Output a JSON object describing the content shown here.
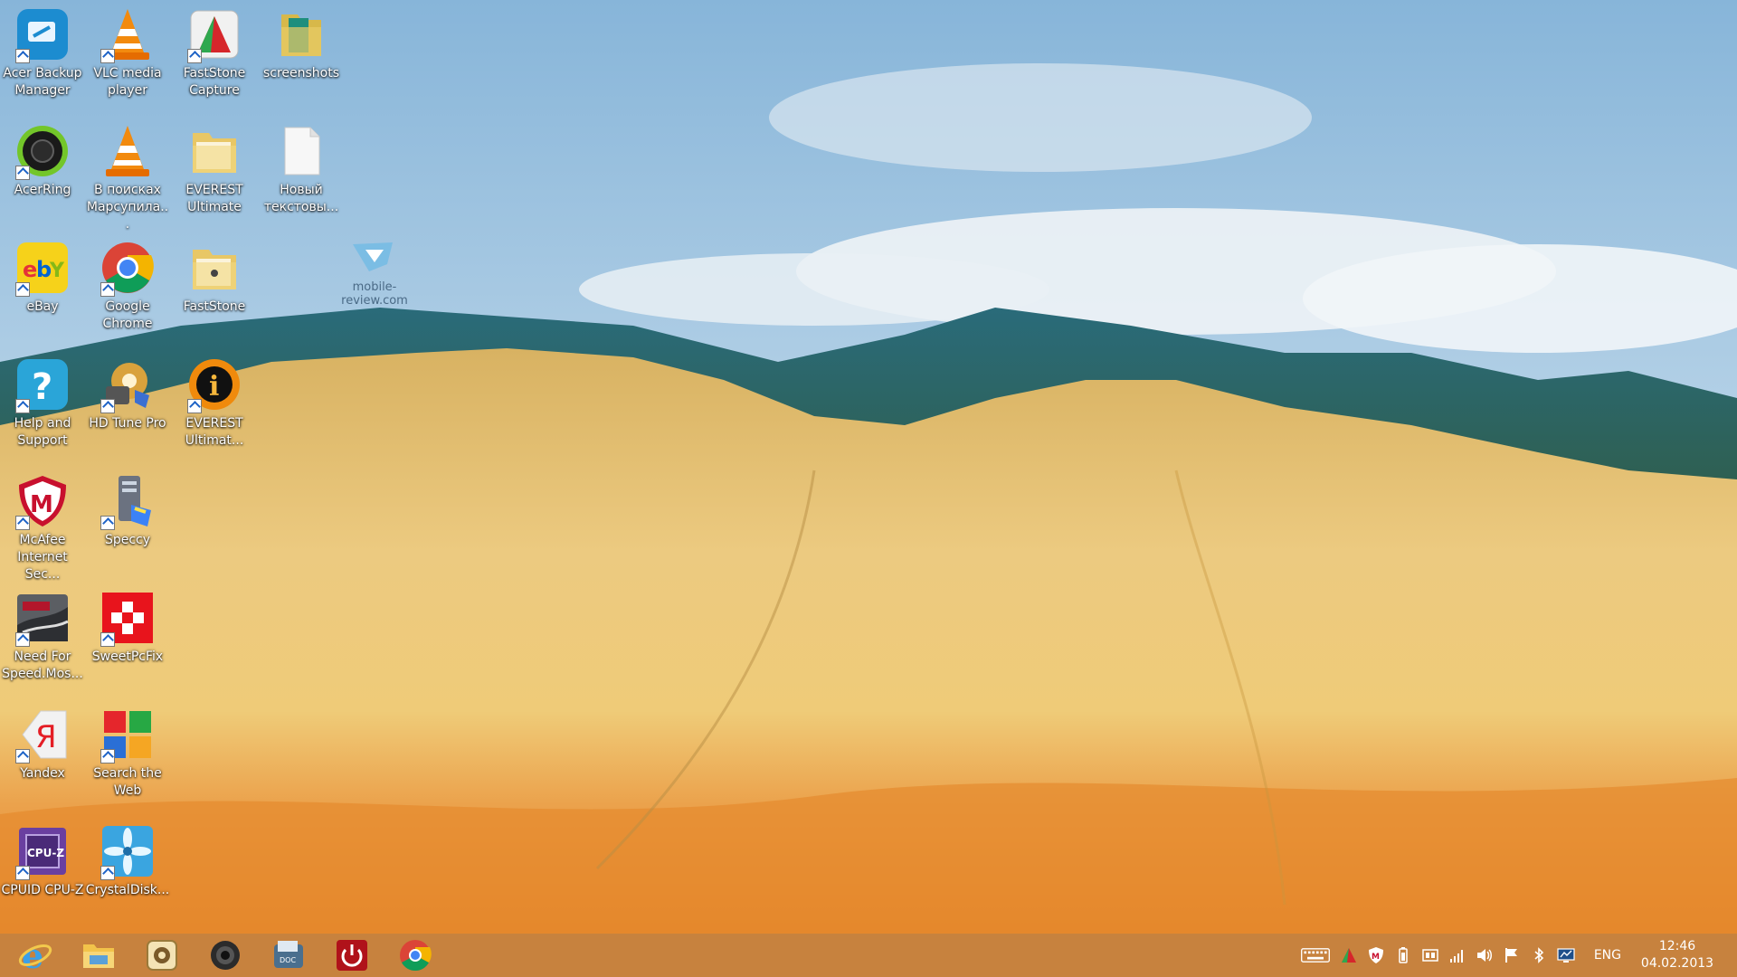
{
  "desktop": {
    "watermark": "mobile-review.com",
    "icons": [
      {
        "label": "Acer Backup Manager",
        "icon": "acer-backup-icon",
        "shortcut": true
      },
      {
        "label": "VLC media player",
        "icon": "vlc-icon",
        "shortcut": true
      },
      {
        "label": "FastStone Capture",
        "icon": "faststone-capture-icon",
        "shortcut": true
      },
      {
        "label": "screenshots",
        "icon": "folder-icon",
        "shortcut": false
      },
      {
        "label": "AcerRing",
        "icon": "acerring-icon",
        "shortcut": true
      },
      {
        "label": "В поисках Марсупила...",
        "icon": "vlc-icon",
        "shortcut": false
      },
      {
        "label": "EVEREST Ultimate",
        "icon": "folder-icon",
        "shortcut": false
      },
      {
        "label": "Новый текстовы...",
        "icon": "text-document-icon",
        "shortcut": false
      },
      {
        "label": "eBay",
        "icon": "ebay-icon",
        "shortcut": true
      },
      {
        "label": "Google Chrome",
        "icon": "chrome-icon",
        "shortcut": true
      },
      {
        "label": "FastStone",
        "icon": "folder-icon",
        "shortcut": false
      },
      {
        "label": "Help and Support",
        "icon": "help-icon",
        "shortcut": true
      },
      {
        "label": "HD Tune Pro",
        "icon": "hdtune-icon",
        "shortcut": true
      },
      {
        "label": "EVEREST Ultimat...",
        "icon": "everest-icon",
        "shortcut": true
      },
      {
        "label": "McAfee Internet Sec...",
        "icon": "mcafee-icon",
        "shortcut": true
      },
      {
        "label": "Speccy",
        "icon": "speccy-icon",
        "shortcut": true
      },
      {
        "label": "Need For Speed.Mos...",
        "icon": "nfs-icon",
        "shortcut": true
      },
      {
        "label": "SweetPcFix",
        "icon": "sweetpcfix-icon",
        "shortcut": true
      },
      {
        "label": "Yandex",
        "icon": "yandex-icon",
        "shortcut": true
      },
      {
        "label": "Search the Web",
        "icon": "search-web-icon",
        "shortcut": true
      },
      {
        "label": "CPUID CPU-Z",
        "icon": "cpuz-icon",
        "shortcut": true
      },
      {
        "label": "CrystalDisk...",
        "icon": "crystaldisk-icon",
        "shortcut": true
      }
    ]
  },
  "taskbar": {
    "apps": [
      "internet-explorer-icon",
      "file-explorer-icon",
      "media-app-icon",
      "webcam-icon",
      "document-scanner-icon",
      "power-button-icon",
      "chrome-icon"
    ],
    "tray": {
      "icons": [
        "keyboard-icon",
        "faststone-tray-icon",
        "mcafee-shield-icon",
        "battery-icon",
        "network-adapter-icon",
        "signal-icon",
        "volume-icon",
        "flag-icon",
        "bluetooth-icon",
        "display-icon"
      ],
      "language": "ENG",
      "time": "12:46",
      "date": "04.02.2013"
    }
  },
  "colors": {
    "taskbar": "#bd6e1e",
    "sky": "#a9cbe3",
    "hills": "#e6c27a",
    "orange_band": "#e58c2d"
  }
}
